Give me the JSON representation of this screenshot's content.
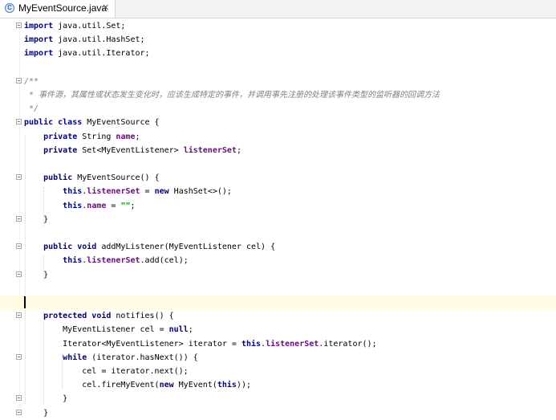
{
  "tab": {
    "icon_letter": "C",
    "label": "MyEventSource.java",
    "close_glyph": "✕"
  },
  "code_lines": [
    [
      {
        "t": "import",
        "c": "kw"
      },
      {
        "t": " java.util.Set;"
      }
    ],
    [
      {
        "t": "import",
        "c": "kw"
      },
      {
        "t": " java.util.HashSet;"
      }
    ],
    [
      {
        "t": "import",
        "c": "kw"
      },
      {
        "t": " java.util.Iterator;"
      }
    ],
    [],
    [
      {
        "t": "/**",
        "c": "cmt"
      }
    ],
    [
      {
        "t": " * 事件源，其属性或状态发生变化时，应该生成特定的事件，并调用事先注册的处理该事件类型的监听器的回调方法",
        "c": "cmt"
      }
    ],
    [
      {
        "t": " */",
        "c": "cmt"
      }
    ],
    [
      {
        "t": "public class",
        "c": "kw"
      },
      {
        "t": " MyEventSource {"
      }
    ],
    [
      {
        "t": "    "
      },
      {
        "t": "private",
        "c": "kw"
      },
      {
        "t": " String "
      },
      {
        "t": "name",
        "c": "fld"
      },
      {
        "t": ";"
      }
    ],
    [
      {
        "t": "    "
      },
      {
        "t": "private",
        "c": "kw"
      },
      {
        "t": " Set<MyEventListener> "
      },
      {
        "t": "listenerSet",
        "c": "fld"
      },
      {
        "t": ";"
      }
    ],
    [],
    [
      {
        "t": "    "
      },
      {
        "t": "public",
        "c": "kw"
      },
      {
        "t": " MyEventSource() {"
      }
    ],
    [
      {
        "t": "        "
      },
      {
        "t": "this",
        "c": "kw"
      },
      {
        "t": "."
      },
      {
        "t": "listenerSet",
        "c": "fld"
      },
      {
        "t": " = "
      },
      {
        "t": "new",
        "c": "kw"
      },
      {
        "t": " HashSet<>();"
      }
    ],
    [
      {
        "t": "        "
      },
      {
        "t": "this",
        "c": "kw"
      },
      {
        "t": "."
      },
      {
        "t": "name",
        "c": "fld"
      },
      {
        "t": " = "
      },
      {
        "t": "\"\"",
        "c": "str"
      },
      {
        "t": ";"
      }
    ],
    [
      {
        "t": "    }"
      }
    ],
    [],
    [
      {
        "t": "    "
      },
      {
        "t": "public void",
        "c": "kw"
      },
      {
        "t": " addMyListener(MyEventListener cel) {"
      }
    ],
    [
      {
        "t": "        "
      },
      {
        "t": "this",
        "c": "kw"
      },
      {
        "t": "."
      },
      {
        "t": "listenerSet",
        "c": "fld"
      },
      {
        "t": ".add(cel);"
      }
    ],
    [
      {
        "t": "    }"
      }
    ],
    [],
    [],
    [
      {
        "t": "    "
      },
      {
        "t": "protected void",
        "c": "kw"
      },
      {
        "t": " notifies() {"
      }
    ],
    [
      {
        "t": "        MyEventListener cel = "
      },
      {
        "t": "null",
        "c": "kw"
      },
      {
        "t": ";"
      }
    ],
    [
      {
        "t": "        Iterator<MyEventListener> iterator = "
      },
      {
        "t": "this",
        "c": "kw"
      },
      {
        "t": "."
      },
      {
        "t": "listenerSet",
        "c": "fld"
      },
      {
        "t": ".iterator();"
      }
    ],
    [
      {
        "t": "        "
      },
      {
        "t": "while",
        "c": "kw"
      },
      {
        "t": " (iterator.hasNext()) {"
      }
    ],
    [
      {
        "t": "            cel = iterator.next();"
      }
    ],
    [
      {
        "t": "            cel.fireMyEvent("
      },
      {
        "t": "new",
        "c": "kw"
      },
      {
        "t": " MyEvent("
      },
      {
        "t": "this",
        "c": "kw"
      },
      {
        "t": "));"
      }
    ],
    [
      {
        "t": "        }"
      }
    ],
    [
      {
        "t": "    }"
      }
    ]
  ],
  "colors": {
    "keyword": "#000080",
    "field": "#660e7a",
    "comment": "#808080",
    "string": "#008000",
    "current_line": "#fffae3"
  }
}
